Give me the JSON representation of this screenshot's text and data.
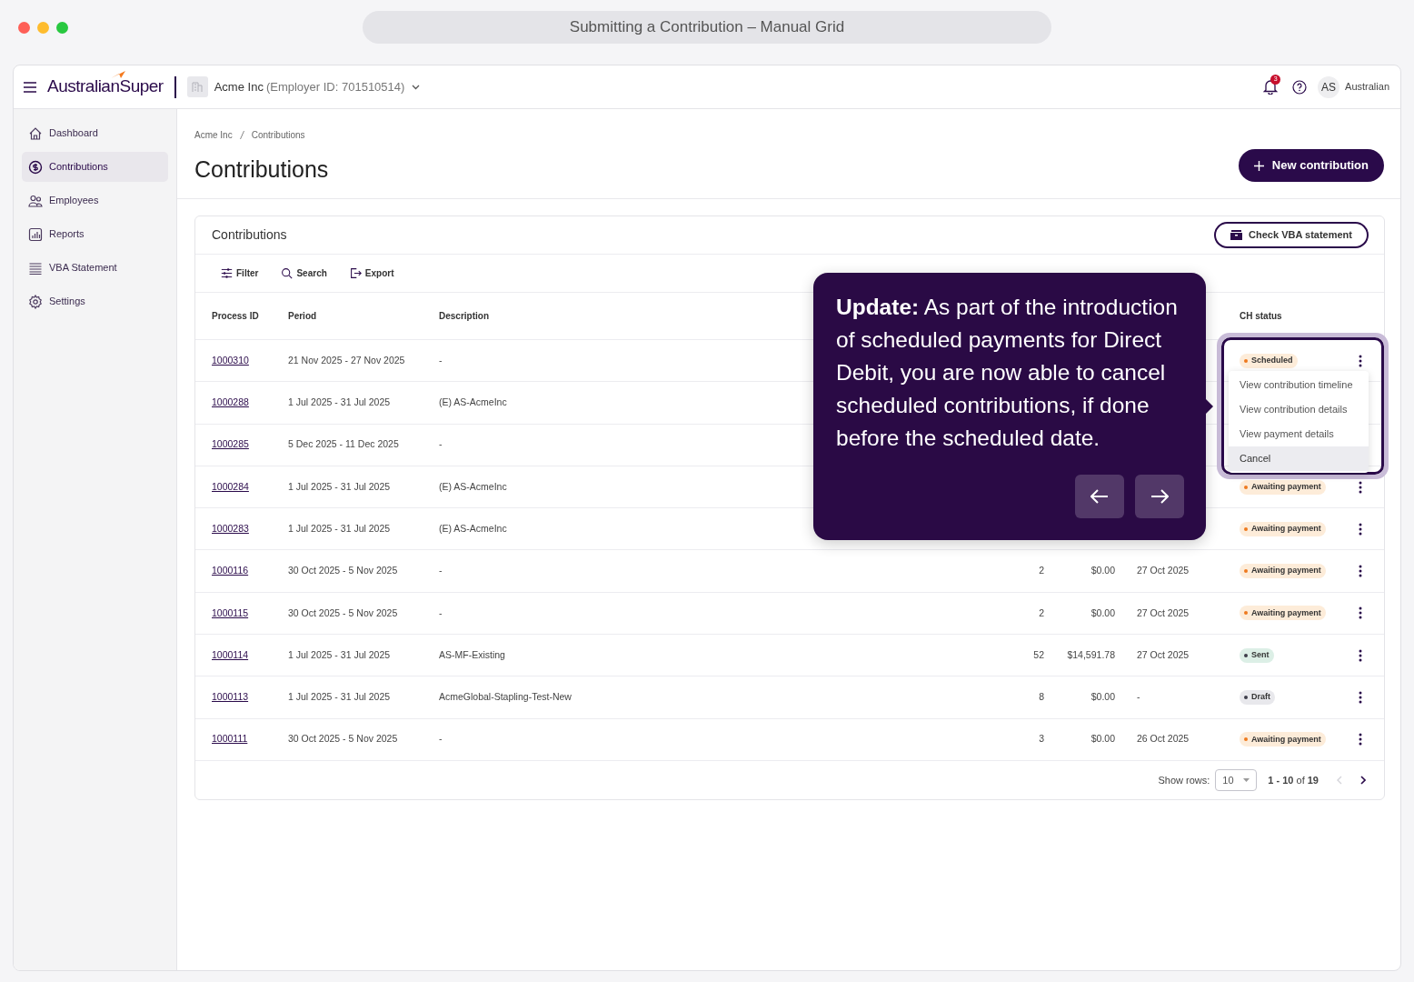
{
  "window": {
    "title": "Submitting a Contribution – Manual Grid"
  },
  "header": {
    "logo": "AustralianSuper",
    "employer_name": "Acme Inc",
    "employer_id": "(Employer ID: 701510514)",
    "notification_count": "3",
    "avatar": "AS",
    "user_name": "Australian"
  },
  "sidebar": {
    "items": [
      {
        "label": "Dashboard",
        "selected": false
      },
      {
        "label": "Contributions",
        "selected": true
      },
      {
        "label": "Employees",
        "selected": false
      },
      {
        "label": "Reports",
        "selected": false
      },
      {
        "label": "VBA Statement",
        "selected": false
      },
      {
        "label": "Settings",
        "selected": false
      }
    ]
  },
  "breadcrumb": [
    "Acme Inc",
    "Contributions"
  ],
  "page_title": "Contributions",
  "new_button": "New contribution",
  "card": {
    "title": "Contributions",
    "vba_button": "Check VBA statement",
    "toolbar": [
      "Filter",
      "Search",
      "Export"
    ],
    "columns": [
      "Process ID",
      "Period",
      "Description",
      "CH status"
    ],
    "rows": [
      {
        "id": "1000310",
        "period": "21 Nov 2025 - 27 Nov 2025",
        "description": "-",
        "status": {
          "label": "Scheduled",
          "kind": "pending"
        }
      },
      {
        "id": "1000288",
        "period": "1 Jul 2025 - 31 Jul 2025",
        "description": "(E) AS-AcmeInc"
      },
      {
        "id": "1000285",
        "period": "5 Dec 2025 - 11 Dec 2025",
        "description": "-"
      },
      {
        "id": "1000284",
        "period": "1 Jul 2025 - 31 Jul 2025",
        "description": "(E) AS-AcmeInc",
        "status": {
          "label": "Awaiting payment",
          "kind": "pending"
        }
      },
      {
        "id": "1000283",
        "period": "1 Jul 2025 - 31 Jul 2025",
        "description": "(E) AS-AcmeInc",
        "status": {
          "label": "Awaiting payment",
          "kind": "pending"
        }
      },
      {
        "id": "1000116",
        "period": "30 Oct 2025 - 5 Nov 2025",
        "description": "-",
        "column_4": "2",
        "column_5": "$0.00",
        "column_6": "27 Oct 2025",
        "status": {
          "label": "Awaiting payment",
          "kind": "pending"
        }
      },
      {
        "id": "1000115",
        "period": "30 Oct 2025 - 5 Nov 2025",
        "description": "-",
        "column_4": "2",
        "column_5": "$0.00",
        "column_6": "27 Oct 2025",
        "status": {
          "label": "Awaiting payment",
          "kind": "pending"
        }
      },
      {
        "id": "1000114",
        "period": "1 Jul 2025 - 31 Jul 2025",
        "description": "AS-MF-Existing",
        "column_4": "52",
        "column_5": "$14,591.78",
        "column_6": "27 Oct 2025",
        "status": {
          "label": "Sent",
          "kind": "sent"
        }
      },
      {
        "id": "1000113",
        "period": "1 Jul 2025 - 31 Jul 2025",
        "description": "AcmeGlobal-Stapling-Test-New",
        "column_4": "8",
        "column_5": "$0.00",
        "column_6": "-",
        "status": {
          "label": "Draft",
          "kind": "draft"
        }
      },
      {
        "id": "1000111",
        "period": "30 Oct 2025 - 5 Nov 2025",
        "description": "-",
        "column_4": "3",
        "column_5": "$0.00",
        "column_6": "26 Oct 2025",
        "status": {
          "label": "Awaiting payment",
          "kind": "pending"
        }
      }
    ],
    "footer": {
      "show_rows_label": "Show rows:",
      "rows_value": "10",
      "range": "**1 - 10** of **19**",
      "prev_disabled": true
    }
  },
  "row_menu": {
    "items": [
      {
        "label": "View contribution timeline",
        "selected": false
      },
      {
        "label": "View contribution details",
        "selected": false
      },
      {
        "label": "View payment details",
        "selected": false
      },
      {
        "label": "Cancel",
        "selected": true
      }
    ]
  },
  "tour_tip": {
    "text": "**Update:** As part of the introduction of scheduled payments for Direct Debit, you are now able to cancel scheduled contributions, if done before the scheduled date."
  }
}
